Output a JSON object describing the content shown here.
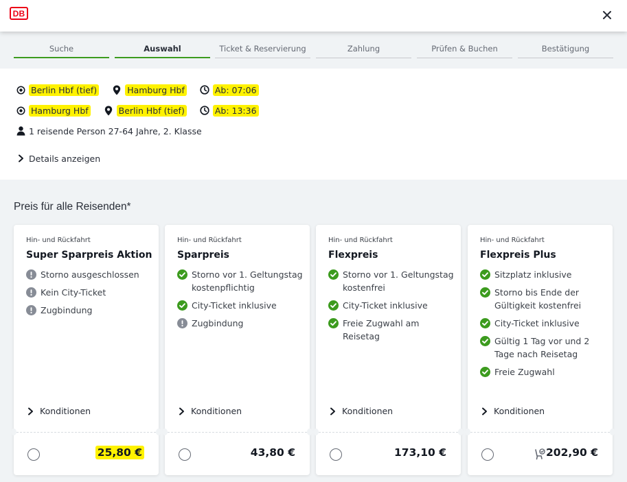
{
  "header": {
    "logo_text": "DB",
    "close_icon": "close-icon"
  },
  "stepper": {
    "steps": [
      {
        "label": "Suche",
        "state": "done"
      },
      {
        "label": "Auswahl",
        "state": "active"
      },
      {
        "label": "Ticket & Reservierung",
        "state": "upcoming"
      },
      {
        "label": "Zahlung",
        "state": "upcoming"
      },
      {
        "label": "Prüfen & Buchen",
        "state": "upcoming"
      },
      {
        "label": "Bestätigung",
        "state": "upcoming"
      }
    ]
  },
  "journey": {
    "outbound": {
      "from": "Berlin Hbf (tief)",
      "to": "Hamburg Hbf",
      "departure": "Ab: 07:06"
    },
    "return": {
      "from": "Hamburg Hbf",
      "to": "Berlin Hbf (tief)",
      "departure": "Ab: 13:36"
    },
    "travelers": "1 reisende Person 27-64 Jahre, 2. Klasse",
    "details_link": "Details anzeigen"
  },
  "fares": {
    "section_title": "Preis für alle Reisenden*",
    "cards": [
      {
        "kicker": "Hin- und Rückfahrt",
        "name": "Super Sparpreis Aktion",
        "features": [
          {
            "icon": "warn",
            "text": "Storno ausgeschlossen"
          },
          {
            "icon": "warn",
            "text": "Kein City-Ticket"
          },
          {
            "icon": "warn",
            "text": "Zugbindung"
          }
        ],
        "conditions_label": "Konditionen",
        "price": "25,80 €",
        "price_highlighted": true,
        "seat_icon": false
      },
      {
        "kicker": "Hin- und Rückfahrt",
        "name": "Sparpreis",
        "features": [
          {
            "icon": "check",
            "text": "Storno vor 1. Geltungstag kostenpflichtig"
          },
          {
            "icon": "check",
            "text": "City-Ticket inklusive"
          },
          {
            "icon": "warn",
            "text": "Zugbindung"
          }
        ],
        "conditions_label": "Konditionen",
        "price": "43,80 €",
        "price_highlighted": false,
        "seat_icon": false
      },
      {
        "kicker": "Hin- und Rückfahrt",
        "name": "Flexpreis",
        "features": [
          {
            "icon": "check",
            "text": "Storno vor 1. Geltungstag kostenfrei"
          },
          {
            "icon": "check",
            "text": "City-Ticket inklusive"
          },
          {
            "icon": "check",
            "text": "Freie Zugwahl am Reisetag"
          }
        ],
        "conditions_label": "Konditionen",
        "price": "173,10 €",
        "price_highlighted": false,
        "seat_icon": false
      },
      {
        "kicker": "Hin- und Rückfahrt",
        "name": "Flexpreis Plus",
        "features": [
          {
            "icon": "check",
            "text": "Sitzplatz inklusive"
          },
          {
            "icon": "check",
            "text": "Storno bis Ende der Gültigkeit kostenfrei"
          },
          {
            "icon": "check",
            "text": "City-Ticket inklusive"
          },
          {
            "icon": "check",
            "text": "Gültig 1 Tag vor und 2 Tage nach Reisetag"
          },
          {
            "icon": "check",
            "text": "Freie Zugwahl"
          }
        ],
        "conditions_label": "Konditionen",
        "price": "202,90 €",
        "price_highlighted": false,
        "seat_icon": true
      }
    ]
  },
  "colors": {
    "brand_red": "#ec0016",
    "step_green": "#3c9b1e",
    "highlight_yellow": "#fff200",
    "page_bg": "#f0f3f5"
  }
}
